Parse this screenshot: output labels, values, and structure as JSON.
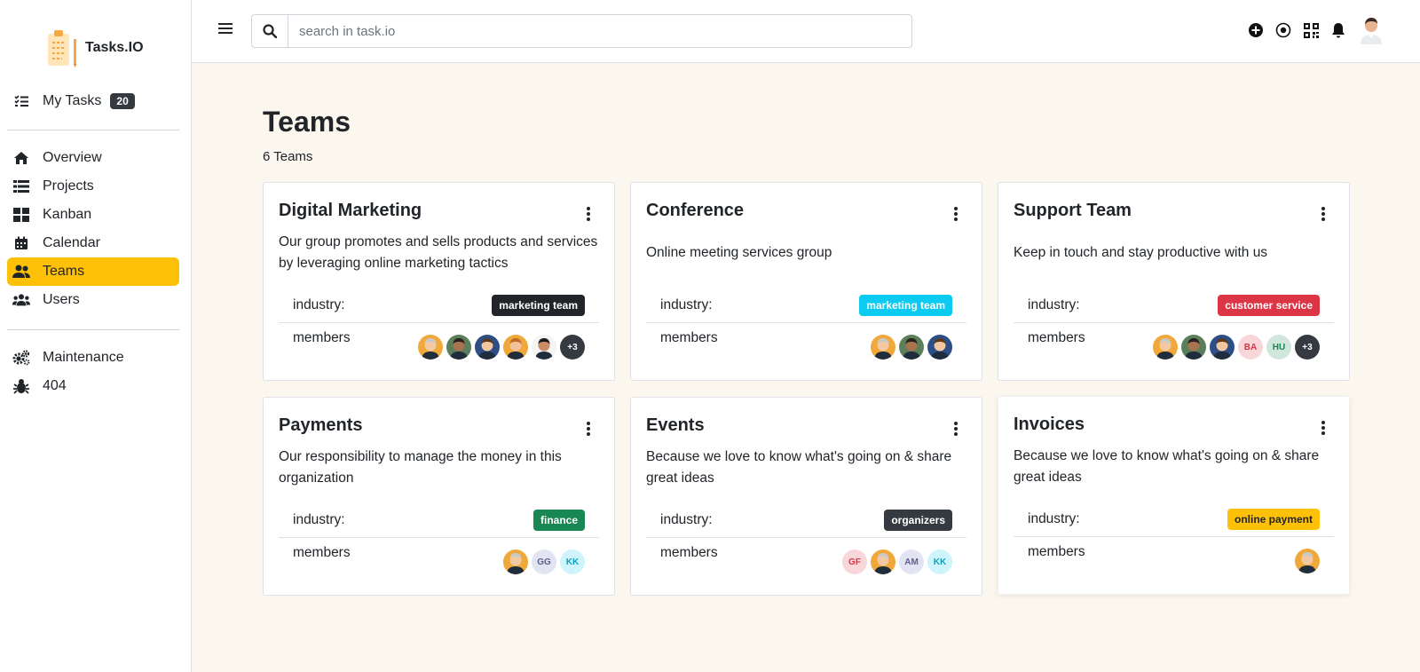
{
  "brand": {
    "name": "Tasks.IO"
  },
  "sidebar": {
    "my_tasks": {
      "label": "My Tasks",
      "count": "20"
    },
    "items": [
      {
        "label": "Overview",
        "icon": "home-icon"
      },
      {
        "label": "Projects",
        "icon": "list-icon"
      },
      {
        "label": "Kanban",
        "icon": "grid-icon"
      },
      {
        "label": "Calendar",
        "icon": "calendar-icon"
      },
      {
        "label": "Teams",
        "icon": "users-icon",
        "active": true
      },
      {
        "label": "Users",
        "icon": "user-group-icon"
      }
    ],
    "extra": [
      {
        "label": "Maintenance",
        "icon": "cogs-icon"
      },
      {
        "label": "404",
        "icon": "bug-icon"
      }
    ]
  },
  "topbar": {
    "search_placeholder": "search in task.io",
    "icons": [
      "plus-circle-icon",
      "compass-icon",
      "qrcode-icon",
      "bell-icon",
      "user-avatar"
    ]
  },
  "page": {
    "title": "Teams",
    "subtitle": "6 Teams"
  },
  "labels": {
    "industry": "industry:",
    "members": "members"
  },
  "colors": {
    "active": "#ffc107",
    "dark": "#212529",
    "info": "#0dcaf0",
    "danger": "#dc3545",
    "success": "#198754",
    "warning": "#ffc107"
  },
  "teams": [
    {
      "name": "Digital Marketing",
      "description": "Our group promotes and sells products and services by leveraging online marketing tactics",
      "industry": "marketing team",
      "tag_color": "#212529",
      "tag_text": "#ffffff",
      "members": [
        {
          "type": "photo"
        },
        {
          "type": "photo"
        },
        {
          "type": "photo"
        },
        {
          "type": "photo"
        },
        {
          "type": "photo"
        },
        {
          "type": "more",
          "text": "+3"
        }
      ]
    },
    {
      "name": "Conference",
      "description": "Online meeting services group",
      "industry": "marketing team",
      "tag_color": "#0dcaf0",
      "tag_text": "#ffffff",
      "members": [
        {
          "type": "photo"
        },
        {
          "type": "photo"
        },
        {
          "type": "photo"
        }
      ]
    },
    {
      "name": "Support Team",
      "description": "Keep in touch and stay productive with us",
      "industry": "customer service",
      "tag_color": "#dc3545",
      "tag_text": "#ffffff",
      "members": [
        {
          "type": "photo"
        },
        {
          "type": "photo"
        },
        {
          "type": "photo"
        },
        {
          "type": "initials",
          "text": "BA",
          "bg": "#f8d7da",
          "fg": "#dc3545"
        },
        {
          "type": "initials",
          "text": "HU",
          "bg": "#d1e7dd",
          "fg": "#198754"
        },
        {
          "type": "more",
          "text": "+3"
        }
      ]
    },
    {
      "name": "Payments",
      "description": "Our responsibility to manage the money in this organization",
      "industry": "finance",
      "tag_color": "#198754",
      "tag_text": "#ffffff",
      "members": [
        {
          "type": "photo"
        },
        {
          "type": "initials",
          "text": "GG",
          "bg": "#e2e3f3",
          "fg": "#5a5f8c"
        },
        {
          "type": "initials",
          "text": "KK",
          "bg": "#cff4fc",
          "fg": "#0aa2c0"
        }
      ]
    },
    {
      "name": "Events",
      "description": "Because we love to know what's going on & share great ideas",
      "industry": "organizers",
      "tag_color": "#343a40",
      "tag_text": "#ffffff",
      "members": [
        {
          "type": "initials",
          "text": "GF",
          "bg": "#f8d7da",
          "fg": "#dc3545"
        },
        {
          "type": "photo"
        },
        {
          "type": "initials",
          "text": "AM",
          "bg": "#e2e3f3",
          "fg": "#5a5f8c"
        },
        {
          "type": "initials",
          "text": "KK",
          "bg": "#cff4fc",
          "fg": "#0aa2c0"
        }
      ]
    },
    {
      "name": "Invoices",
      "description": "Because we love to know what's going on & share great ideas",
      "industry": "online payment",
      "tag_color": "#ffc107",
      "tag_text": "#212529",
      "members": [
        {
          "type": "photo"
        }
      ]
    }
  ]
}
